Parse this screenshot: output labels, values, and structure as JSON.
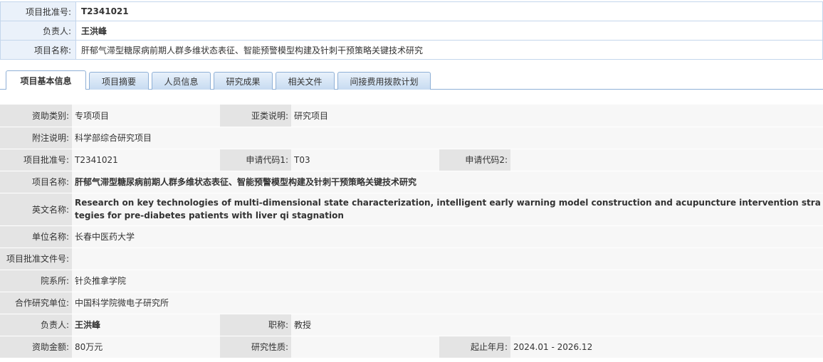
{
  "header": {
    "approval_no_label": "项目批准号:",
    "approval_no": "T2341021",
    "leader_label": "负责人:",
    "leader": "王洪峰",
    "project_name_label": "项目名称:",
    "project_name": "肝郁气滞型糖尿病前期人群多维状态表征、智能预警模型构建及针刺干预策略关键技术研究"
  },
  "tabs": [
    {
      "label": "项目基本信息",
      "active": true
    },
    {
      "label": "项目摘要",
      "active": false
    },
    {
      "label": "人员信息",
      "active": false
    },
    {
      "label": "研究成果",
      "active": false
    },
    {
      "label": "相关文件",
      "active": false
    },
    {
      "label": "间接费用拨款计划",
      "active": false
    }
  ],
  "info": {
    "funding_type_label": "资助类别:",
    "funding_type": "专项项目",
    "subtype_label": "亚类说明:",
    "subtype": "研究项目",
    "note_label": "附注说明:",
    "note": "科学部综合研究项目",
    "approval_no_label": "项目批准号:",
    "approval_no": "T2341021",
    "apply_code1_label": "申请代码1:",
    "apply_code1": "T03",
    "apply_code2_label": "申请代码2:",
    "apply_code2": "",
    "project_name_label": "项目名称:",
    "project_name": "肝郁气滞型糖尿病前期人群多维状态表征、智能预警模型构建及针刺干预策略关键技术研究",
    "english_name_label": "英文名称:",
    "english_name": "Research on key technologies of multi-dimensional state characterization, intelligent early warning model construction and acupuncture intervention strategies for pre-diabetes patients with liver qi stagnation",
    "unit_label": "单位名称:",
    "unit": "长春中医药大学",
    "approval_doc_label": "项目批准文件号:",
    "approval_doc": "",
    "department_label": "院系所:",
    "department": "针灸推拿学院",
    "coop_unit_label": "合作研究单位:",
    "coop_unit": "中国科学院微电子研究所",
    "leader_label": "负责人:",
    "leader": "王洪峰",
    "title_label": "职称:",
    "title": "教授",
    "amount_label": "资助金额:",
    "amount": "80万元",
    "nature_label": "研究性质:",
    "nature": "",
    "period_label": "起止年月:",
    "period": "2024.01 - 2026.12"
  }
}
